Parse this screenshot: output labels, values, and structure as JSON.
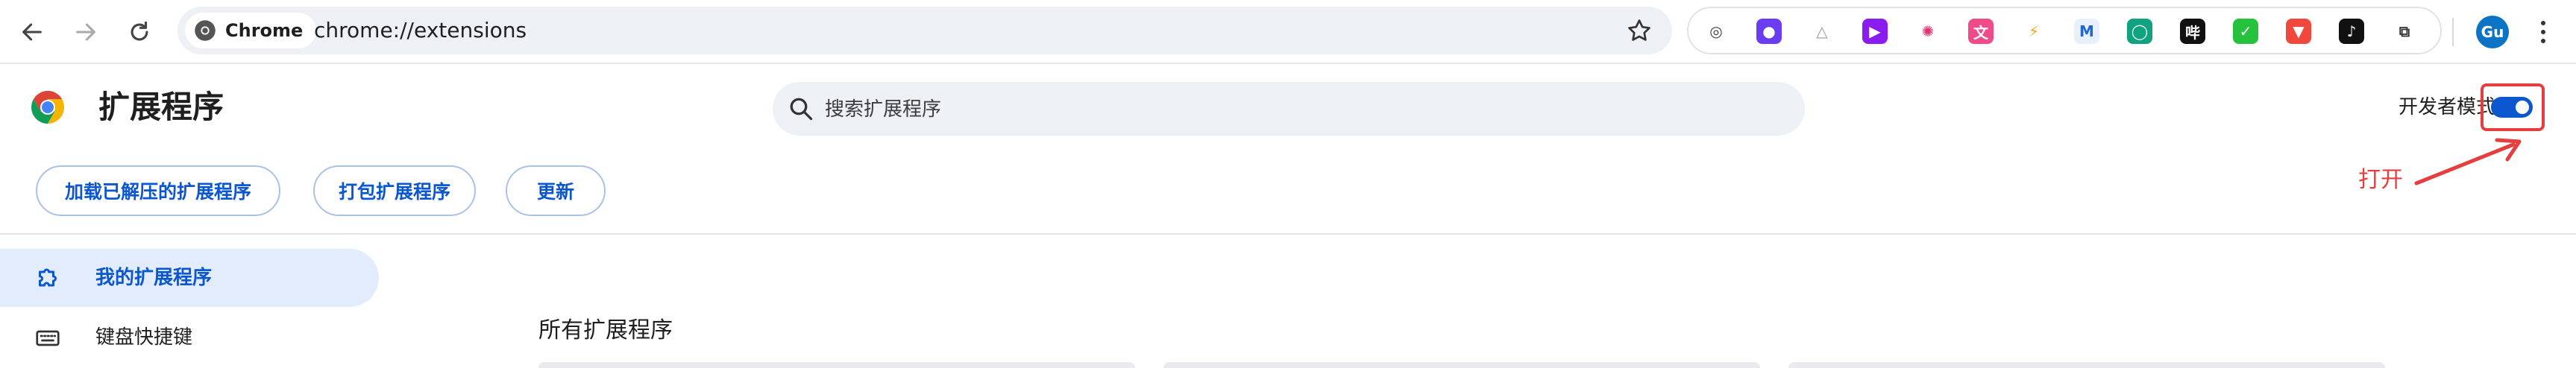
{
  "browser": {
    "chip_label": "Chrome",
    "url": "chrome://extensions",
    "avatar_initials": "Gu",
    "extension_icons": [
      {
        "name": "sound-icon",
        "bg": "#ffffff",
        "fg": "#444444",
        "glyph": "◎"
      },
      {
        "name": "robot-icon",
        "bg": "#6a3df0",
        "fg": "#ffffff",
        "glyph": "●"
      },
      {
        "name": "triangle-logo-icon",
        "bg": "#ffffff",
        "fg": "#999999",
        "glyph": "△"
      },
      {
        "name": "play-icon",
        "bg": "#8a1cf0",
        "fg": "#ffffff",
        "glyph": "▶"
      },
      {
        "name": "openai-icon",
        "bg": "#ffffff",
        "fg": "#e0326f",
        "glyph": "✺"
      },
      {
        "name": "translate-icon",
        "bg": "#f04a8a",
        "fg": "#ffffff",
        "glyph": "文"
      },
      {
        "name": "bolt-icon",
        "bg": "#ffffff",
        "fg": "#f2a614",
        "glyph": "⚡"
      },
      {
        "name": "markdown-icon",
        "bg": "#e8f0fb",
        "fg": "#2266cc",
        "glyph": "M"
      },
      {
        "name": "chat-bubble-icon",
        "bg": "#10a37f",
        "fg": "#ffffff",
        "glyph": "◯"
      },
      {
        "name": "reader-icon",
        "bg": "#111111",
        "fg": "#ffffff",
        "glyph": "哔"
      },
      {
        "name": "checkmark-icon",
        "bg": "#25c23d",
        "fg": "#ffffff",
        "glyph": "✓"
      },
      {
        "name": "brave-lion-icon",
        "bg": "#f0483d",
        "fg": "#ffffff",
        "glyph": "▼"
      },
      {
        "name": "tiktok-icon",
        "bg": "#111111",
        "fg": "#ffffff",
        "glyph": "♪"
      },
      {
        "name": "puzzle-icon",
        "bg": "#ffffff",
        "fg": "#333333",
        "glyph": "⧉"
      }
    ]
  },
  "header": {
    "title": "扩展程序",
    "search_placeholder": "搜索扩展程序",
    "dev_mode_label": "开发者模式",
    "dev_mode_on": true,
    "annotation": "打开"
  },
  "actions": {
    "load_unpacked": "加载已解压的扩展程序",
    "pack": "打包扩展程序",
    "update": "更新"
  },
  "sidebar": {
    "items": [
      {
        "label": "我的扩展程序",
        "active": true
      },
      {
        "label": "键盘快捷键",
        "active": false
      }
    ]
  },
  "main": {
    "section_title": "所有扩展程序"
  },
  "colors": {
    "accent": "#0b57d0",
    "annotation": "#e63e3e",
    "active_bg": "#e3ecfd"
  }
}
